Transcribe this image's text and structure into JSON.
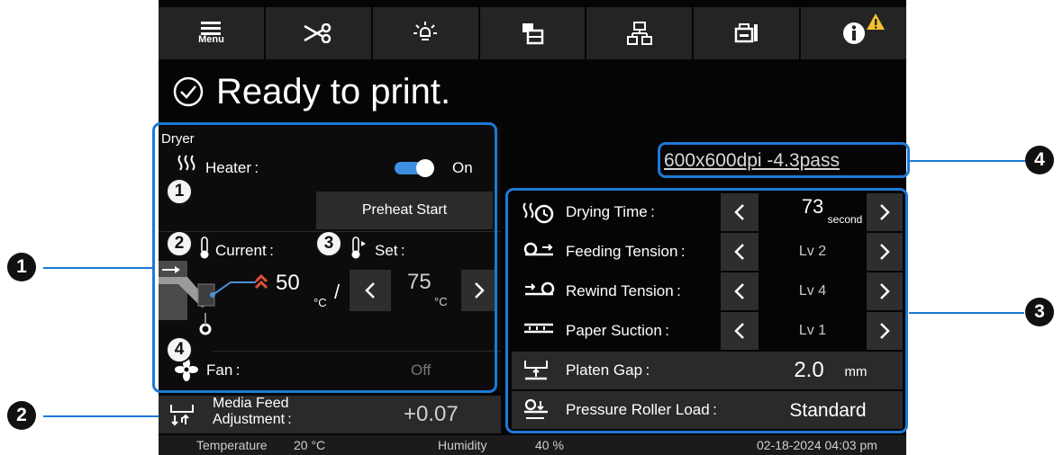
{
  "toolbar": {
    "menu_label": "Menu",
    "icons": [
      "menu-icon",
      "cut-icon",
      "light-icon",
      "layout-icon",
      "network-icon",
      "maintenance-icon",
      "info-icon"
    ]
  },
  "status_message": "Ready to print.",
  "dryer": {
    "title": "Dryer",
    "heater_label": "Heater :",
    "heater_state": "On",
    "preheat_label": "Preheat Start",
    "current_label": "Current :",
    "set_label": "Set :",
    "current_value": "50",
    "current_unit": "°C",
    "separator": "/",
    "set_value": "75",
    "set_unit": "°C",
    "fan_label": "Fan :",
    "fan_state": "Off"
  },
  "media_feed": {
    "label_line1": "Media Feed",
    "label_line2": "Adjustment :",
    "value": "+0.07"
  },
  "resolution": "600x600dpi -4.3pass",
  "settings": {
    "drying_time": {
      "label": "Drying Time :",
      "value": "73",
      "unit": "second"
    },
    "feeding_tension": {
      "label": "Feeding Tension :",
      "value": "Lv 2"
    },
    "rewind_tension": {
      "label": "Rewind Tension :",
      "value": "Lv 4"
    },
    "paper_suction": {
      "label": "Paper Suction :",
      "value": "Lv 1"
    },
    "platen_gap": {
      "label": "Platen Gap :",
      "value": "2.0",
      "unit": "mm"
    },
    "pressure_roller": {
      "label": "Pressure Roller Load :",
      "value": "Standard"
    }
  },
  "status_bar": {
    "temperature_label": "Temperature",
    "temperature_value": "20 °C",
    "humidity_label": "Humidity",
    "humidity_value": "40 %",
    "datetime": "02-18-2024 04:03 pm"
  },
  "callouts": {
    "badges": [
      "1",
      "2",
      "3",
      "4"
    ],
    "circled": [
      "1",
      "2",
      "3",
      "4"
    ]
  },
  "colors": {
    "callout_blue": "#1d7ad6",
    "toggle_blue": "#3d8fe0",
    "warning_yellow": "#f2c230",
    "heat_arrow": "#e0503a"
  }
}
